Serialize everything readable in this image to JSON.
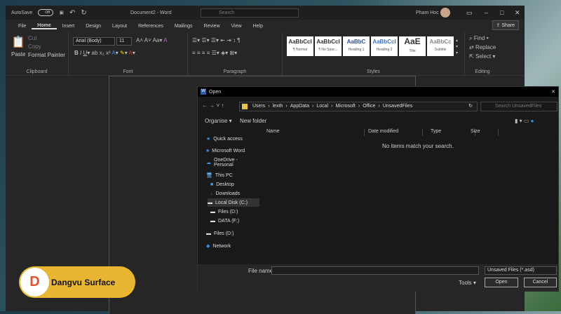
{
  "titlebar": {
    "autosave": "AutoSave",
    "toggle": "Off",
    "title": "Document2 - Word",
    "search": "Search",
    "user": "Pham Hoc"
  },
  "tabs": [
    "File",
    "Home",
    "Insert",
    "Design",
    "Layout",
    "References",
    "Mailings",
    "Review",
    "View",
    "Help"
  ],
  "share": "Share",
  "clipboard": {
    "paste": "Paste",
    "cut": "Cut",
    "copy": "Copy",
    "format_painter": "Format Painter",
    "label": "Clipboard"
  },
  "font": {
    "name": "Arial (Body)",
    "size": "11",
    "label": "Font"
  },
  "paragraph": {
    "label": "Paragraph"
  },
  "styles": {
    "items": [
      {
        "sample": "AaBbCcI",
        "name": "¶ Normal"
      },
      {
        "sample": "AaBbCcI",
        "name": "¶ No Spac..."
      },
      {
        "sample": "AaBbC",
        "name": "Heading 1"
      },
      {
        "sample": "AaBbCcI",
        "name": "Heading 2"
      },
      {
        "sample": "AaE",
        "name": "Title"
      },
      {
        "sample": "AaBbCc",
        "name": "Subtitle"
      }
    ],
    "label": "Styles"
  },
  "editing": {
    "find": "Find",
    "replace": "Replace",
    "select": "Select",
    "label": "Editing"
  },
  "dialog": {
    "title": "Open",
    "path": [
      "Users",
      "lexth",
      "AppData",
      "Local",
      "Microsoft",
      "Office",
      "UnsavedFiles"
    ],
    "search": "Search UnsavedFiles",
    "organise": "Organise ▾",
    "new_folder": "New folder",
    "nav": [
      "Quick access",
      "Microsoft Word",
      "OneDrive - Personal",
      "This PC",
      "Desktop",
      "Downloads",
      "Local Disk (C:)",
      "Files (D:)",
      "DATA (F:)",
      "Files (D:)",
      "Network"
    ],
    "columns": [
      "Name",
      "Date modified",
      "Type",
      "Size"
    ],
    "empty": "No items match your search.",
    "file_name_label": "File name:",
    "file_name": "",
    "file_type": "Unsaved Files (*.asd)",
    "tools": "Tools",
    "open": "Open",
    "cancel": "Cancel"
  },
  "logo": "Dangvu Surface"
}
